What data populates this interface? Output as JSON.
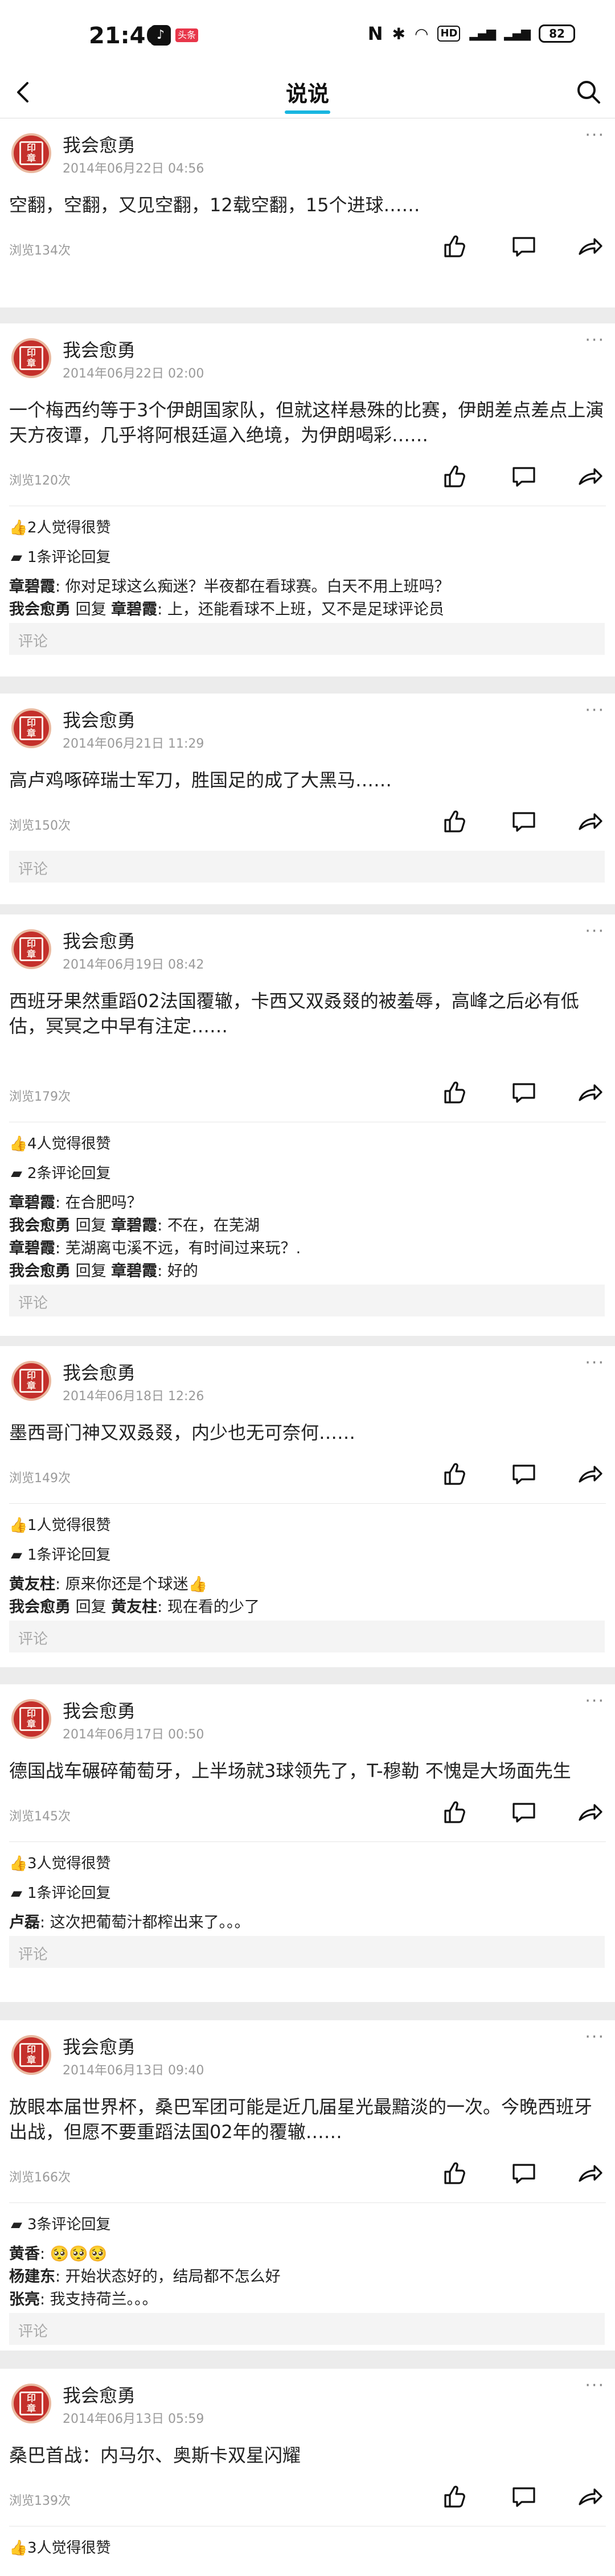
{
  "status_bar": {
    "time": "21:46",
    "app_badge": "头条",
    "battery": "82"
  },
  "nav": {
    "title": "说说"
  },
  "comment_placeholder": "评论",
  "posts": [
    {
      "user": "我会愈勇",
      "date": "2014年06月22日 04:56",
      "text": "空翻，空翻，又见空翻，12载空翻，15个进球……",
      "views": "浏览134次"
    },
    {
      "user": "我会愈勇",
      "date": "2014年06月22日 02:00",
      "text": "一个梅西约等于3个伊朗国家队，但就这样悬殊的比赛，伊朗差点差点上演天方夜谭，几乎将阿根廷逼入绝境，为伊朗喝彩……",
      "views": "浏览120次",
      "likes": "2人觉得很赞",
      "replies": "1条评论回复",
      "comments": [
        {
          "name": "章碧霞",
          "text": ": 你对足球这么痴迷？半夜都在看球赛。白天不用上班吗？"
        },
        {
          "name": "我会愈勇",
          "reply": " 回复 ",
          "target": "章碧霞",
          "text": ": 上，还能看球不上班，又不是足球评论员"
        }
      ]
    },
    {
      "user": "我会愈勇",
      "date": "2014年06月21日 11:29",
      "text": "高卢鸡啄碎瑞士军刀，胜国足的成了大黑马……",
      "views": "浏览150次"
    },
    {
      "user": "我会愈勇",
      "date": "2014年06月19日 08:42",
      "text": "西班牙果然重蹈02法国覆辙，卡西又双叒叕的被羞辱，高峰之后必有低估，冥冥之中早有注定……",
      "views": "浏览179次",
      "likes": "4人觉得很赞",
      "replies": "2条评论回复",
      "comments": [
        {
          "name": "章碧霞",
          "text": ": 在合肥吗？"
        },
        {
          "name": "我会愈勇",
          "reply": " 回复 ",
          "target": "章碧霞",
          "text": ": 不在，在芜湖"
        },
        {
          "name": "章碧霞",
          "text": ": 芜湖离屯溪不远，有时间过来玩？."
        },
        {
          "name": "我会愈勇",
          "reply": " 回复 ",
          "target": "章碧霞",
          "text": ": 好的"
        }
      ]
    },
    {
      "user": "我会愈勇",
      "date": "2014年06月18日 12:26",
      "text": "墨西哥门神又双叒叕，内少也无可奈何……",
      "views": "浏览149次",
      "likes": "1人觉得很赞",
      "replies": "1条评论回复",
      "comments": [
        {
          "name": "黄友柱",
          "text": ": 原来你还是个球迷👍"
        },
        {
          "name": "我会愈勇",
          "reply": " 回复 ",
          "target": "黄友柱",
          "text": ": 现在看的少了"
        }
      ]
    },
    {
      "user": "我会愈勇",
      "date": "2014年06月17日 00:50",
      "text": "德国战车碾碎葡萄牙，上半场就3球领先了，T-穆勒   不愧是大场面先生",
      "views": "浏览145次",
      "likes": "3人觉得很赞",
      "replies": "1条评论回复",
      "comments": [
        {
          "name": "卢磊",
          "text": ": 这次把葡萄汁都榨出来了。。。"
        }
      ]
    },
    {
      "user": "我会愈勇",
      "date": "2014年06月13日 09:40",
      "text": "放眼本届世界杯，桑巴军团可能是近几届星光最黯淡的一次。今晚西班牙出战，但愿不要重蹈法国02年的覆辙……",
      "views": "浏览166次",
      "replies": "3条评论回复",
      "comments": [
        {
          "name": "黄香",
          "text": ": 🥺🥺🥺"
        },
        {
          "name": "杨建东",
          "text": ": 开始状态好的，结局都不怎么好"
        },
        {
          "name": "张亮",
          "text": ": 我支持荷兰。。。"
        }
      ]
    },
    {
      "user": "我会愈勇",
      "date": "2014年06月13日 05:59",
      "text": "桑巴首战：内马尔、奥斯卡双星闪耀",
      "views": "浏览139次",
      "likes": "3人觉得很赞"
    }
  ]
}
